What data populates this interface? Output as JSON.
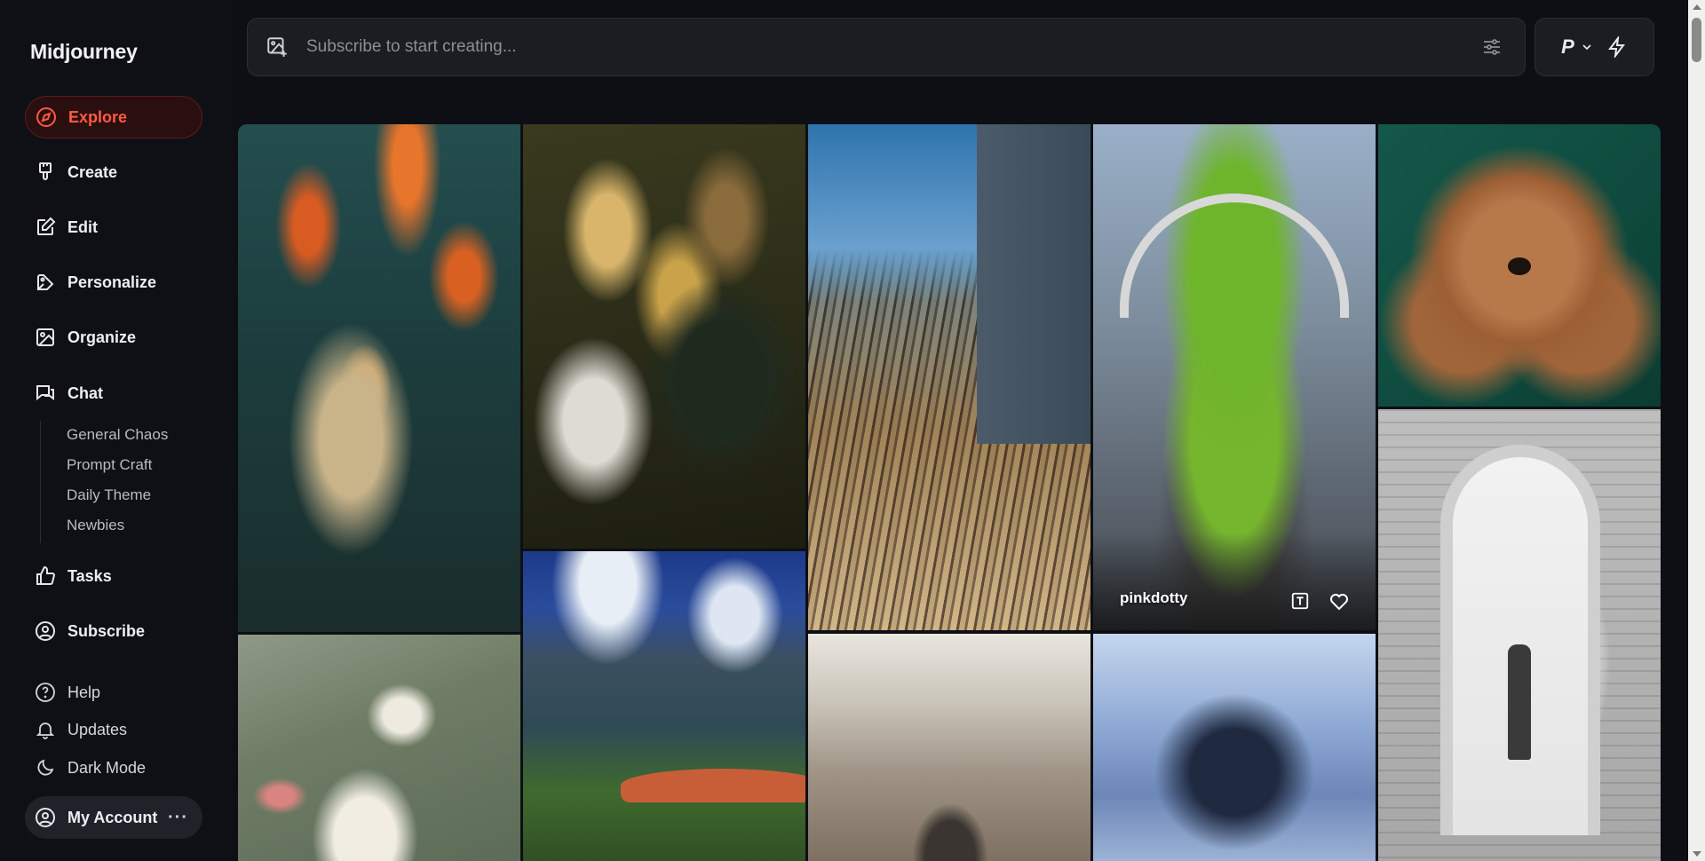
{
  "sidebar": {
    "logo": "Midjourney",
    "nav": {
      "explore": "Explore",
      "create": "Create",
      "edit": "Edit",
      "personalize": "Personalize",
      "organize": "Organize",
      "chat": "Chat",
      "tasks": "Tasks",
      "subscribe": "Subscribe"
    },
    "chat_channels": [
      "General Chaos",
      "Prompt Craft",
      "Daily Theme",
      "Newbies"
    ],
    "footer": {
      "help": "Help",
      "updates": "Updates",
      "dark_mode": "Dark Mode",
      "account": "My Account",
      "account_more": "···"
    }
  },
  "prompt": {
    "placeholder": "Subscribe to start creating..."
  },
  "actions": {
    "profile_initial": "P"
  },
  "gallery": {
    "hover_tile": {
      "username": "pinkdotty"
    }
  },
  "colors": {
    "accent": "#ff5a43",
    "background": "#0d0f14"
  },
  "icons": {
    "explore": "compass-icon",
    "create": "brush-icon",
    "edit": "edit-icon",
    "personalize": "personalize-icon",
    "organize": "image-icon",
    "chat": "chat-icon",
    "tasks": "thumbs-up-icon",
    "subscribe": "user-circle-icon",
    "help": "help-icon",
    "updates": "bell-icon",
    "dark_mode": "moon-icon"
  }
}
